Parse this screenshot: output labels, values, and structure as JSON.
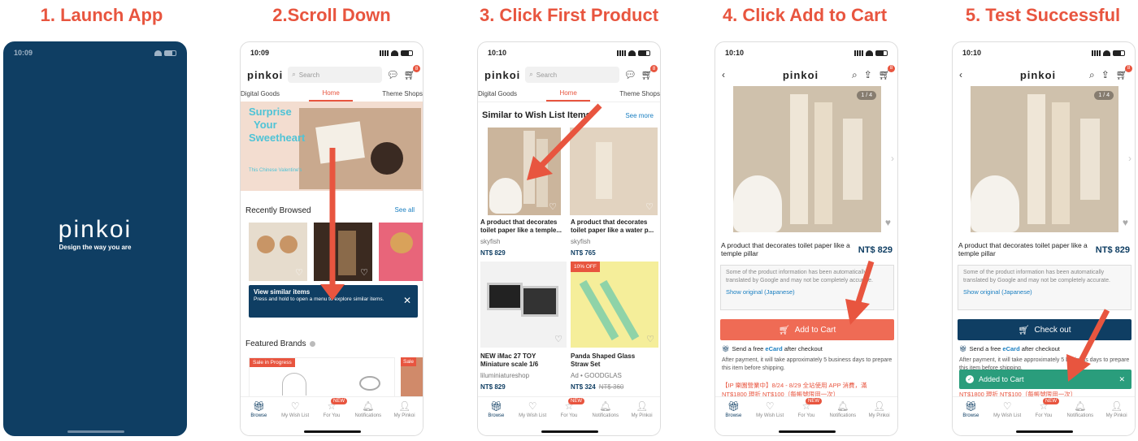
{
  "steps": [
    {
      "title": "1. Launch App"
    },
    {
      "title": "2.Scroll Down"
    },
    {
      "title": "3. Click First Product"
    },
    {
      "title": "4. Click Add to Cart"
    },
    {
      "title": "5. Test Successful"
    }
  ],
  "colors": {
    "accent": "#e8553f",
    "navy": "#0f3e63",
    "green": "#2a9d7c"
  },
  "splash": {
    "time": "10:09",
    "logo": "pinkoi",
    "tagline": "Design the way you are"
  },
  "common": {
    "time2": "10:09",
    "time3": "10:10",
    "time4": "10:10",
    "time5": "10:10",
    "logo": "pinkoi",
    "search_placeholder": "Search",
    "cart_count": "8",
    "tabs": [
      "Digital Goods",
      "Home",
      "Theme Shops"
    ],
    "nav": [
      "Browse",
      "My Wish List",
      "For You",
      "Notifications",
      "My Pinkoi"
    ],
    "new_badge": "NEW"
  },
  "screen2": {
    "banner_text": [
      "Surprise",
      "Your",
      "Sweetheart"
    ],
    "banner_sub": "This Chinese Valentine's",
    "recently_browsed": "Recently Browsed",
    "see_all": "See all",
    "tooltip_title": "View similar items",
    "tooltip_body": "Press and hold to open a menu to explore similar items.",
    "featured_brands": "Featured Brands",
    "sale_badge": "Sale in Progress",
    "sale_badge2": "Sale"
  },
  "screen3": {
    "section_title": "Similar to Wish List Items",
    "see_more": "See more",
    "products": [
      {
        "title": "A product that decorates toilet paper like a temple...",
        "shop": "skyfish",
        "price": "NT$ 829"
      },
      {
        "title": "A product that decorates toilet paper like a water p...",
        "shop": "skyfish",
        "price": "NT$ 765"
      },
      {
        "title": "NEW iMac 27 TOY Miniature scale 1/6",
        "shop": "liluminiatureshop",
        "price": "NT$ 829"
      },
      {
        "title": "Panda Shaped Glass Straw Set",
        "shop": "Ad • GOODGLAS",
        "price": "NT$ 324",
        "old_price": "NT$ 360",
        "discount": "10% OFF"
      }
    ]
  },
  "product": {
    "counter": "1 / 4",
    "title": "A product that decorates toilet paper like a temple pillar",
    "price": "NT$ 829",
    "translate_note": "Some of the product information has been automatically translated by Google and may not be completely accurate.",
    "show_original": "Show original (Japanese)",
    "add_to_cart": "Add to Cart",
    "checkout": "Check out",
    "ecard_pre": "Send a free ",
    "ecard_word": "eCard",
    "ecard_post": " after checkout",
    "ship_note": "After payment, it will take approximately 5 business days to prepare this item before shipping.",
    "promo_line1": "【IP 樂園營業中】8/24 - 8/29 全站使用 APP 消費，滿",
    "promo_line2": "NT$1800 現折 NT$100（每帳號限用一次）",
    "added_toast": "Added to Cart"
  }
}
